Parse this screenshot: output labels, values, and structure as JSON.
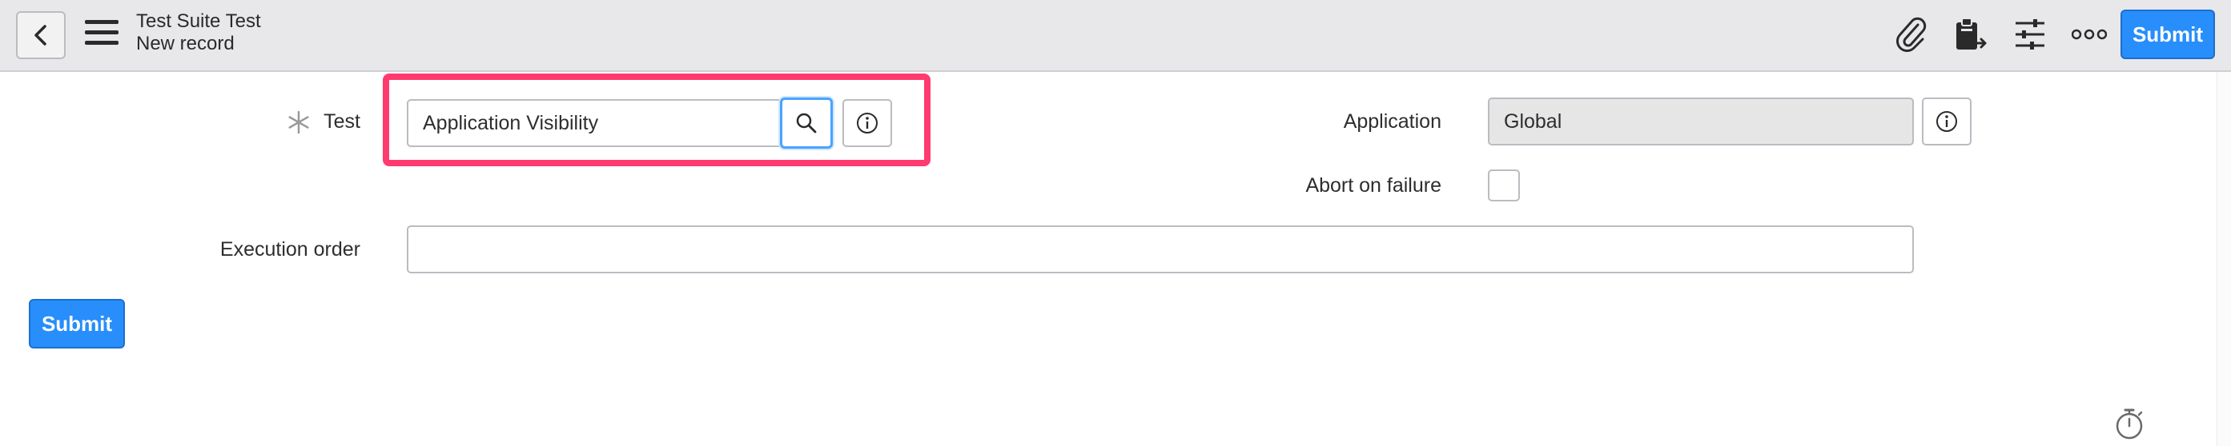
{
  "header": {
    "title": "Test Suite Test",
    "subtitle": "New record",
    "submit_label": "Submit",
    "icons": [
      "back-icon",
      "menu-icon",
      "paperclip-icon",
      "clipboard-export-icon",
      "sliders-icon",
      "more-icon"
    ]
  },
  "form": {
    "test_label": "Test",
    "test_value": "Application Visibility",
    "application_label": "Application",
    "application_value": "Global",
    "abort_label": "Abort on failure",
    "abort_checked": false,
    "execution_order_label": "Execution order",
    "execution_order_value": "",
    "submit_label": "Submit"
  },
  "colors": {
    "accent": "#278efc",
    "highlight": "#ff3a6e",
    "header_bg": "#e8e8ea"
  }
}
